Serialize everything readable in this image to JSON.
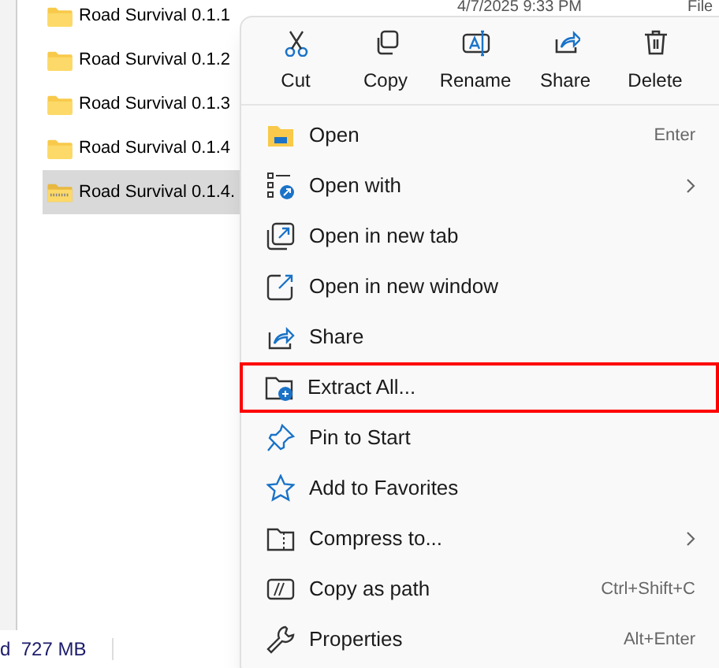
{
  "files": [
    {
      "name": "Road Survival 0.1.1",
      "kind": "folder",
      "selected": false
    },
    {
      "name": "Road Survival 0.1.2",
      "kind": "folder",
      "selected": false
    },
    {
      "name": "Road Survival 0.1.3",
      "kind": "folder",
      "selected": false
    },
    {
      "name": "Road Survival 0.1.4",
      "kind": "folder",
      "selected": false
    },
    {
      "name": "Road Survival 0.1.4.",
      "kind": "zip",
      "selected": true
    }
  ],
  "date_modified": "4/7/2025 9:33 PM",
  "type_column": "File",
  "status_bar": {
    "text": "d  727 MB"
  },
  "context_menu": {
    "toolbar": [
      {
        "label": "Cut",
        "kind": "cut"
      },
      {
        "label": "Copy",
        "kind": "copy"
      },
      {
        "label": "Rename",
        "kind": "rename"
      },
      {
        "label": "Share",
        "kind": "share"
      },
      {
        "label": "Delete",
        "kind": "delete"
      }
    ],
    "items": [
      {
        "label": "Open",
        "kind": "open",
        "shortcut": "Enter",
        "has_submenu": false,
        "highlighted": false
      },
      {
        "label": "Open with",
        "kind": "openwith",
        "has_submenu": true,
        "highlighted": false
      },
      {
        "label": "Open in new tab",
        "kind": "newtab",
        "has_submenu": false,
        "highlighted": false
      },
      {
        "label": "Open in new window",
        "kind": "newwindow",
        "has_submenu": false,
        "highlighted": false
      },
      {
        "label": "Share",
        "kind": "share",
        "has_submenu": false,
        "highlighted": false
      },
      {
        "label": "Extract All...",
        "kind": "extract",
        "has_submenu": false,
        "highlighted": true
      },
      {
        "label": "Pin to Start",
        "kind": "pin",
        "has_submenu": false,
        "highlighted": false
      },
      {
        "label": "Add to Favorites",
        "kind": "star",
        "has_submenu": false,
        "highlighted": false
      },
      {
        "label": "Compress to...",
        "kind": "compress",
        "has_submenu": true,
        "highlighted": false
      },
      {
        "label": "Copy as path",
        "kind": "copypath",
        "shortcut": "Ctrl+Shift+C",
        "has_submenu": false,
        "highlighted": false
      },
      {
        "label": "Properties",
        "kind": "properties",
        "shortcut": "Alt+Enter",
        "has_submenu": false,
        "highlighted": false
      }
    ]
  }
}
